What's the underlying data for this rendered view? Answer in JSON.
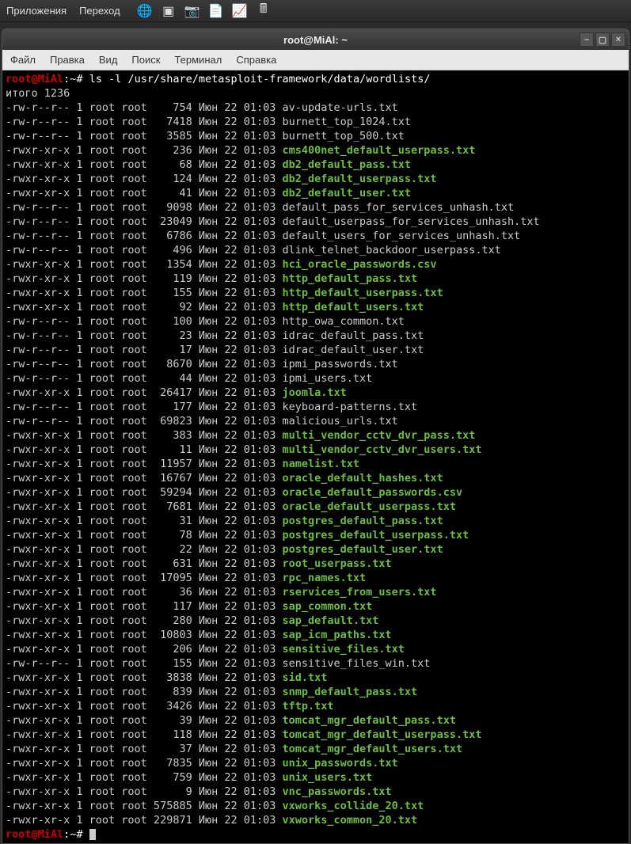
{
  "panel": {
    "apps": "Приложения",
    "go": "Переход"
  },
  "window": {
    "title": "root@MiAl: ~"
  },
  "menubar": {
    "file": "Файл",
    "edit": "Правка",
    "view": "Вид",
    "search": "Поиск",
    "terminal": "Терминал",
    "help": "Справка"
  },
  "prompt": {
    "user": "root@MiAl",
    "sep": ":",
    "path": "~",
    "hash": "#",
    "cmd": "ls -l /usr/share/metasploit-framework/data/wordlists/"
  },
  "total": "итого 1236",
  "files": [
    {
      "perm": "-rw-r--r--",
      "n": "1",
      "u": "root",
      "g": "root",
      "size": "754",
      "m": "Июн",
      "d": "22",
      "t": "01:03",
      "name": "av-update-urls.txt",
      "exec": false
    },
    {
      "perm": "-rw-r--r--",
      "n": "1",
      "u": "root",
      "g": "root",
      "size": "7418",
      "m": "Июн",
      "d": "22",
      "t": "01:03",
      "name": "burnett_top_1024.txt",
      "exec": false
    },
    {
      "perm": "-rw-r--r--",
      "n": "1",
      "u": "root",
      "g": "root",
      "size": "3585",
      "m": "Июн",
      "d": "22",
      "t": "01:03",
      "name": "burnett_top_500.txt",
      "exec": false
    },
    {
      "perm": "-rwxr-xr-x",
      "n": "1",
      "u": "root",
      "g": "root",
      "size": "236",
      "m": "Июн",
      "d": "22",
      "t": "01:03",
      "name": "cms400net_default_userpass.txt",
      "exec": true
    },
    {
      "perm": "-rwxr-xr-x",
      "n": "1",
      "u": "root",
      "g": "root",
      "size": "68",
      "m": "Июн",
      "d": "22",
      "t": "01:03",
      "name": "db2_default_pass.txt",
      "exec": true
    },
    {
      "perm": "-rwxr-xr-x",
      "n": "1",
      "u": "root",
      "g": "root",
      "size": "124",
      "m": "Июн",
      "d": "22",
      "t": "01:03",
      "name": "db2_default_userpass.txt",
      "exec": true
    },
    {
      "perm": "-rwxr-xr-x",
      "n": "1",
      "u": "root",
      "g": "root",
      "size": "41",
      "m": "Июн",
      "d": "22",
      "t": "01:03",
      "name": "db2_default_user.txt",
      "exec": true
    },
    {
      "perm": "-rw-r--r--",
      "n": "1",
      "u": "root",
      "g": "root",
      "size": "9098",
      "m": "Июн",
      "d": "22",
      "t": "01:03",
      "name": "default_pass_for_services_unhash.txt",
      "exec": false
    },
    {
      "perm": "-rw-r--r--",
      "n": "1",
      "u": "root",
      "g": "root",
      "size": "23049",
      "m": "Июн",
      "d": "22",
      "t": "01:03",
      "name": "default_userpass_for_services_unhash.txt",
      "exec": false
    },
    {
      "perm": "-rw-r--r--",
      "n": "1",
      "u": "root",
      "g": "root",
      "size": "6786",
      "m": "Июн",
      "d": "22",
      "t": "01:03",
      "name": "default_users_for_services_unhash.txt",
      "exec": false
    },
    {
      "perm": "-rw-r--r--",
      "n": "1",
      "u": "root",
      "g": "root",
      "size": "496",
      "m": "Июн",
      "d": "22",
      "t": "01:03",
      "name": "dlink_telnet_backdoor_userpass.txt",
      "exec": false
    },
    {
      "perm": "-rwxr-xr-x",
      "n": "1",
      "u": "root",
      "g": "root",
      "size": "1354",
      "m": "Июн",
      "d": "22",
      "t": "01:03",
      "name": "hci_oracle_passwords.csv",
      "exec": true
    },
    {
      "perm": "-rwxr-xr-x",
      "n": "1",
      "u": "root",
      "g": "root",
      "size": "119",
      "m": "Июн",
      "d": "22",
      "t": "01:03",
      "name": "http_default_pass.txt",
      "exec": true
    },
    {
      "perm": "-rwxr-xr-x",
      "n": "1",
      "u": "root",
      "g": "root",
      "size": "155",
      "m": "Июн",
      "d": "22",
      "t": "01:03",
      "name": "http_default_userpass.txt",
      "exec": true
    },
    {
      "perm": "-rwxr-xr-x",
      "n": "1",
      "u": "root",
      "g": "root",
      "size": "92",
      "m": "Июн",
      "d": "22",
      "t": "01:03",
      "name": "http_default_users.txt",
      "exec": true
    },
    {
      "perm": "-rw-r--r--",
      "n": "1",
      "u": "root",
      "g": "root",
      "size": "100",
      "m": "Июн",
      "d": "22",
      "t": "01:03",
      "name": "http_owa_common.txt",
      "exec": false
    },
    {
      "perm": "-rw-r--r--",
      "n": "1",
      "u": "root",
      "g": "root",
      "size": "23",
      "m": "Июн",
      "d": "22",
      "t": "01:03",
      "name": "idrac_default_pass.txt",
      "exec": false
    },
    {
      "perm": "-rw-r--r--",
      "n": "1",
      "u": "root",
      "g": "root",
      "size": "17",
      "m": "Июн",
      "d": "22",
      "t": "01:03",
      "name": "idrac_default_user.txt",
      "exec": false
    },
    {
      "perm": "-rw-r--r--",
      "n": "1",
      "u": "root",
      "g": "root",
      "size": "8670",
      "m": "Июн",
      "d": "22",
      "t": "01:03",
      "name": "ipmi_passwords.txt",
      "exec": false
    },
    {
      "perm": "-rw-r--r--",
      "n": "1",
      "u": "root",
      "g": "root",
      "size": "44",
      "m": "Июн",
      "d": "22",
      "t": "01:03",
      "name": "ipmi_users.txt",
      "exec": false
    },
    {
      "perm": "-rwxr-xr-x",
      "n": "1",
      "u": "root",
      "g": "root",
      "size": "26417",
      "m": "Июн",
      "d": "22",
      "t": "01:03",
      "name": "joomla.txt",
      "exec": true
    },
    {
      "perm": "-rw-r--r--",
      "n": "1",
      "u": "root",
      "g": "root",
      "size": "177",
      "m": "Июн",
      "d": "22",
      "t": "01:03",
      "name": "keyboard-patterns.txt",
      "exec": false
    },
    {
      "perm": "-rw-r--r--",
      "n": "1",
      "u": "root",
      "g": "root",
      "size": "69823",
      "m": "Июн",
      "d": "22",
      "t": "01:03",
      "name": "malicious_urls.txt",
      "exec": false
    },
    {
      "perm": "-rwxr-xr-x",
      "n": "1",
      "u": "root",
      "g": "root",
      "size": "383",
      "m": "Июн",
      "d": "22",
      "t": "01:03",
      "name": "multi_vendor_cctv_dvr_pass.txt",
      "exec": true
    },
    {
      "perm": "-rwxr-xr-x",
      "n": "1",
      "u": "root",
      "g": "root",
      "size": "11",
      "m": "Июн",
      "d": "22",
      "t": "01:03",
      "name": "multi_vendor_cctv_dvr_users.txt",
      "exec": true
    },
    {
      "perm": "-rwxr-xr-x",
      "n": "1",
      "u": "root",
      "g": "root",
      "size": "11957",
      "m": "Июн",
      "d": "22",
      "t": "01:03",
      "name": "namelist.txt",
      "exec": true
    },
    {
      "perm": "-rwxr-xr-x",
      "n": "1",
      "u": "root",
      "g": "root",
      "size": "16767",
      "m": "Июн",
      "d": "22",
      "t": "01:03",
      "name": "oracle_default_hashes.txt",
      "exec": true
    },
    {
      "perm": "-rwxr-xr-x",
      "n": "1",
      "u": "root",
      "g": "root",
      "size": "59294",
      "m": "Июн",
      "d": "22",
      "t": "01:03",
      "name": "oracle_default_passwords.csv",
      "exec": true
    },
    {
      "perm": "-rwxr-xr-x",
      "n": "1",
      "u": "root",
      "g": "root",
      "size": "7681",
      "m": "Июн",
      "d": "22",
      "t": "01:03",
      "name": "oracle_default_userpass.txt",
      "exec": true
    },
    {
      "perm": "-rwxr-xr-x",
      "n": "1",
      "u": "root",
      "g": "root",
      "size": "31",
      "m": "Июн",
      "d": "22",
      "t": "01:03",
      "name": "postgres_default_pass.txt",
      "exec": true
    },
    {
      "perm": "-rwxr-xr-x",
      "n": "1",
      "u": "root",
      "g": "root",
      "size": "78",
      "m": "Июн",
      "d": "22",
      "t": "01:03",
      "name": "postgres_default_userpass.txt",
      "exec": true
    },
    {
      "perm": "-rwxr-xr-x",
      "n": "1",
      "u": "root",
      "g": "root",
      "size": "22",
      "m": "Июн",
      "d": "22",
      "t": "01:03",
      "name": "postgres_default_user.txt",
      "exec": true
    },
    {
      "perm": "-rwxr-xr-x",
      "n": "1",
      "u": "root",
      "g": "root",
      "size": "631",
      "m": "Июн",
      "d": "22",
      "t": "01:03",
      "name": "root_userpass.txt",
      "exec": true
    },
    {
      "perm": "-rwxr-xr-x",
      "n": "1",
      "u": "root",
      "g": "root",
      "size": "17095",
      "m": "Июн",
      "d": "22",
      "t": "01:03",
      "name": "rpc_names.txt",
      "exec": true
    },
    {
      "perm": "-rwxr-xr-x",
      "n": "1",
      "u": "root",
      "g": "root",
      "size": "36",
      "m": "Июн",
      "d": "22",
      "t": "01:03",
      "name": "rservices_from_users.txt",
      "exec": true
    },
    {
      "perm": "-rwxr-xr-x",
      "n": "1",
      "u": "root",
      "g": "root",
      "size": "117",
      "m": "Июн",
      "d": "22",
      "t": "01:03",
      "name": "sap_common.txt",
      "exec": true
    },
    {
      "perm": "-rwxr-xr-x",
      "n": "1",
      "u": "root",
      "g": "root",
      "size": "280",
      "m": "Июн",
      "d": "22",
      "t": "01:03",
      "name": "sap_default.txt",
      "exec": true
    },
    {
      "perm": "-rwxr-xr-x",
      "n": "1",
      "u": "root",
      "g": "root",
      "size": "10803",
      "m": "Июн",
      "d": "22",
      "t": "01:03",
      "name": "sap_icm_paths.txt",
      "exec": true
    },
    {
      "perm": "-rwxr-xr-x",
      "n": "1",
      "u": "root",
      "g": "root",
      "size": "206",
      "m": "Июн",
      "d": "22",
      "t": "01:03",
      "name": "sensitive_files.txt",
      "exec": true
    },
    {
      "perm": "-rw-r--r--",
      "n": "1",
      "u": "root",
      "g": "root",
      "size": "155",
      "m": "Июн",
      "d": "22",
      "t": "01:03",
      "name": "sensitive_files_win.txt",
      "exec": false
    },
    {
      "perm": "-rwxr-xr-x",
      "n": "1",
      "u": "root",
      "g": "root",
      "size": "3838",
      "m": "Июн",
      "d": "22",
      "t": "01:03",
      "name": "sid.txt",
      "exec": true
    },
    {
      "perm": "-rwxr-xr-x",
      "n": "1",
      "u": "root",
      "g": "root",
      "size": "839",
      "m": "Июн",
      "d": "22",
      "t": "01:03",
      "name": "snmp_default_pass.txt",
      "exec": true
    },
    {
      "perm": "-rwxr-xr-x",
      "n": "1",
      "u": "root",
      "g": "root",
      "size": "3426",
      "m": "Июн",
      "d": "22",
      "t": "01:03",
      "name": "tftp.txt",
      "exec": true
    },
    {
      "perm": "-rwxr-xr-x",
      "n": "1",
      "u": "root",
      "g": "root",
      "size": "39",
      "m": "Июн",
      "d": "22",
      "t": "01:03",
      "name": "tomcat_mgr_default_pass.txt",
      "exec": true
    },
    {
      "perm": "-rwxr-xr-x",
      "n": "1",
      "u": "root",
      "g": "root",
      "size": "118",
      "m": "Июн",
      "d": "22",
      "t": "01:03",
      "name": "tomcat_mgr_default_userpass.txt",
      "exec": true
    },
    {
      "perm": "-rwxr-xr-x",
      "n": "1",
      "u": "root",
      "g": "root",
      "size": "37",
      "m": "Июн",
      "d": "22",
      "t": "01:03",
      "name": "tomcat_mgr_default_users.txt",
      "exec": true
    },
    {
      "perm": "-rwxr-xr-x",
      "n": "1",
      "u": "root",
      "g": "root",
      "size": "7835",
      "m": "Июн",
      "d": "22",
      "t": "01:03",
      "name": "unix_passwords.txt",
      "exec": true
    },
    {
      "perm": "-rwxr-xr-x",
      "n": "1",
      "u": "root",
      "g": "root",
      "size": "759",
      "m": "Июн",
      "d": "22",
      "t": "01:03",
      "name": "unix_users.txt",
      "exec": true
    },
    {
      "perm": "-rwxr-xr-x",
      "n": "1",
      "u": "root",
      "g": "root",
      "size": "9",
      "m": "Июн",
      "d": "22",
      "t": "01:03",
      "name": "vnc_passwords.txt",
      "exec": true
    },
    {
      "perm": "-rwxr-xr-x",
      "n": "1",
      "u": "root",
      "g": "root",
      "size": "575885",
      "m": "Июн",
      "d": "22",
      "t": "01:03",
      "name": "vxworks_collide_20.txt",
      "exec": true
    },
    {
      "perm": "-rwxr-xr-x",
      "n": "1",
      "u": "root",
      "g": "root",
      "size": "229871",
      "m": "Июн",
      "d": "22",
      "t": "01:03",
      "name": "vxworks_common_20.txt",
      "exec": true
    }
  ]
}
